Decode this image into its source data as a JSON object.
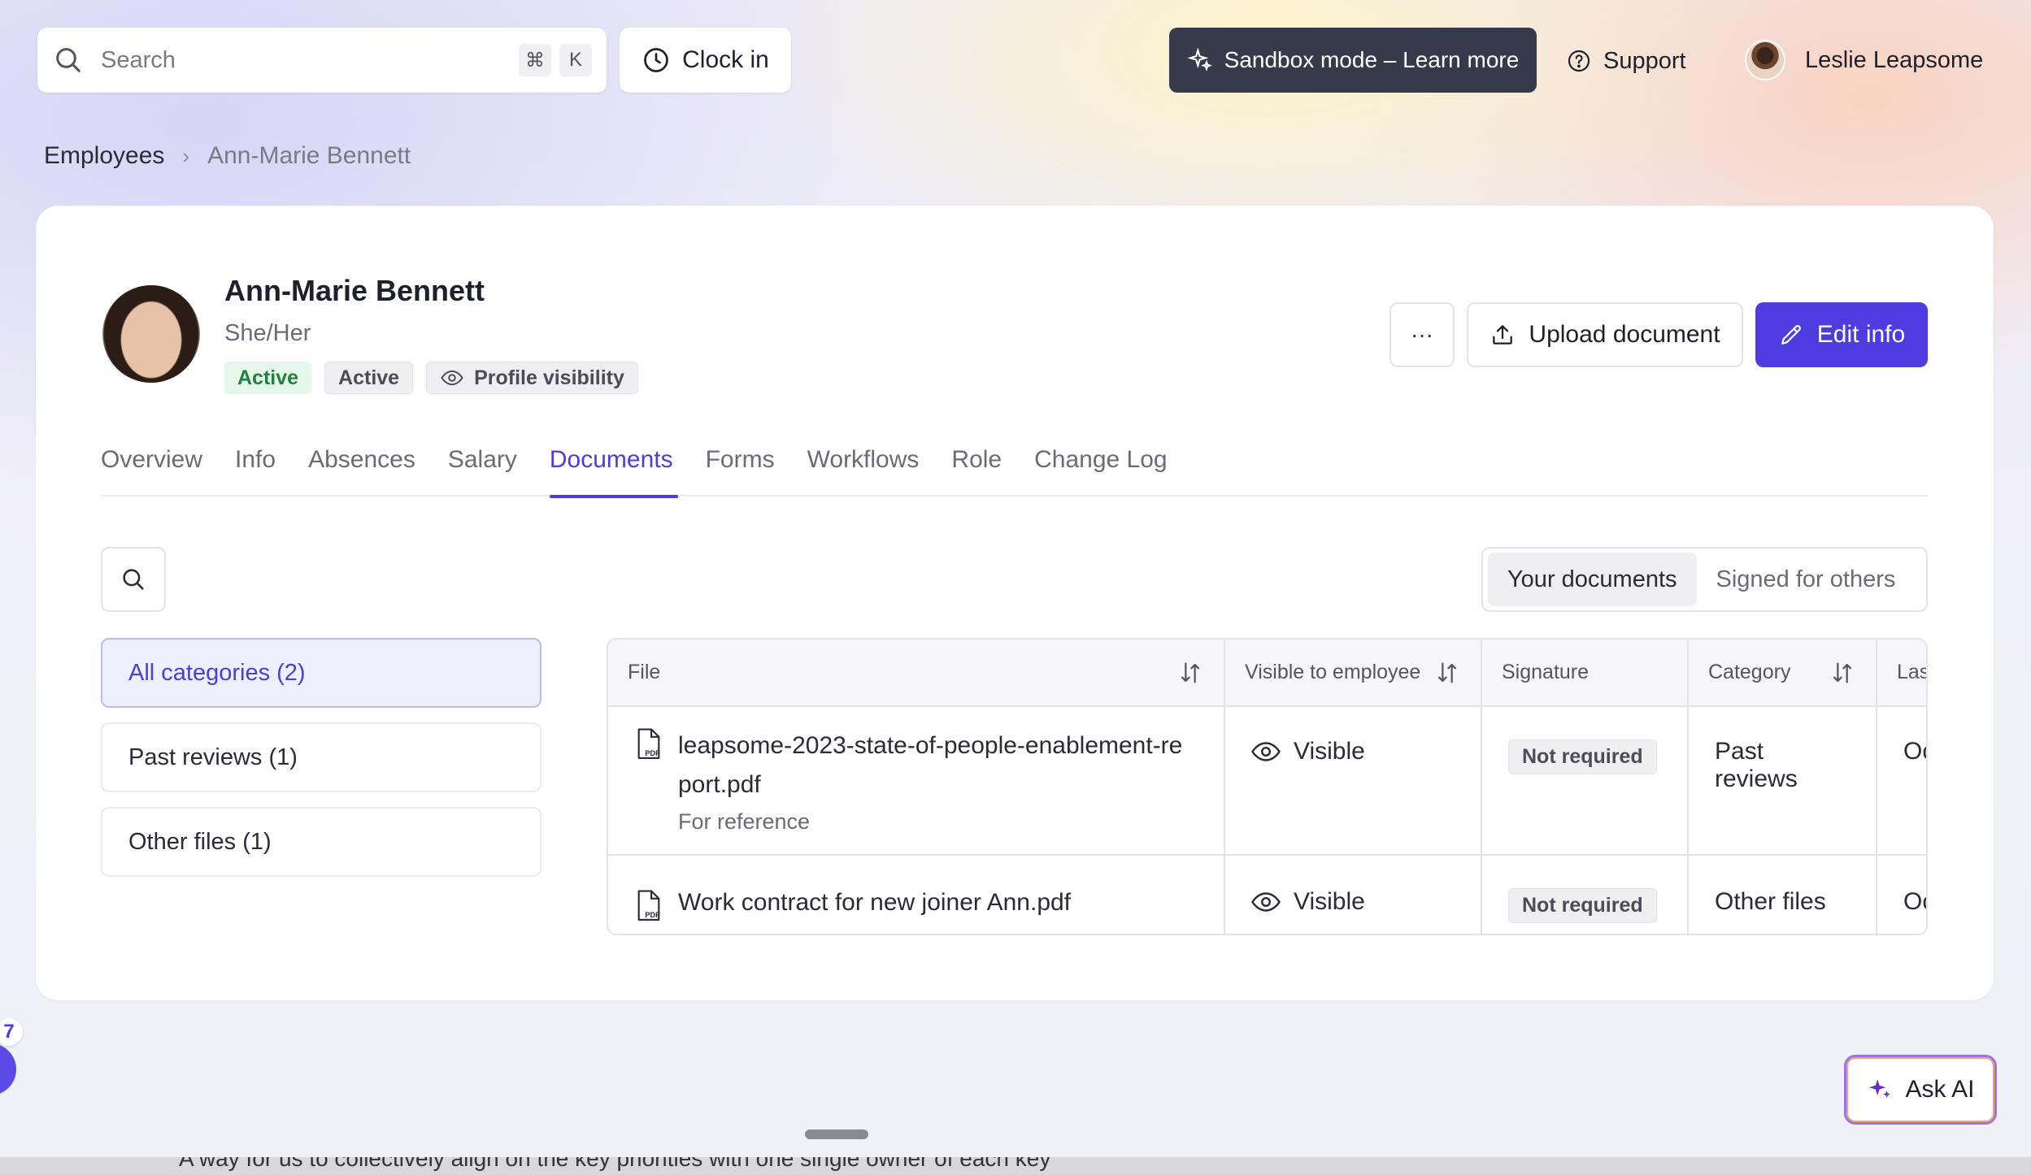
{
  "header": {
    "search_placeholder": "Search",
    "kbd_cmd": "⌘",
    "kbd_k": "K",
    "clock_in": "Clock in",
    "sandbox": "Sandbox mode – Learn more",
    "support": "Support",
    "user_name": "Leslie Leapsome"
  },
  "breadcrumb": {
    "parent": "Employees",
    "current": "Ann-Marie Bennett"
  },
  "profile": {
    "name": "Ann-Marie Bennett",
    "pronouns": "She/Her",
    "badge_status_green": "Active",
    "badge_status_gray": "Active",
    "badge_visibility": "Profile visibility",
    "more": "···",
    "upload": "Upload document",
    "edit": "Edit info"
  },
  "tabs": [
    {
      "label": "Overview"
    },
    {
      "label": "Info"
    },
    {
      "label": "Absences"
    },
    {
      "label": "Salary"
    },
    {
      "label": "Documents"
    },
    {
      "label": "Forms"
    },
    {
      "label": "Workflows"
    },
    {
      "label": "Role"
    },
    {
      "label": "Change Log"
    }
  ],
  "active_tab": "Documents",
  "toggle": {
    "yours": "Your documents",
    "others": "Signed for others"
  },
  "categories": [
    {
      "label": "All categories (2)"
    },
    {
      "label": "Past reviews (1)"
    },
    {
      "label": "Other files (1)"
    }
  ],
  "table": {
    "columns": [
      "File",
      "Visible to employee",
      "Signature",
      "Category",
      "Las"
    ],
    "rows": [
      {
        "file": "leapsome-2023-state-of-people-enablement-report.pdf",
        "file_line1": "leapsome-2023-state-of-people-enablement-re",
        "file_line2": "port.pdf",
        "note": "For reference",
        "visible": "Visible",
        "signature": "Not required",
        "category": "Past reviews",
        "last": "Oc"
      },
      {
        "file": "Work contract for new joiner Ann.pdf",
        "visible": "Visible",
        "signature": "Not required",
        "category": "Other files",
        "last": "Oc"
      }
    ]
  },
  "side_badge_count": "7",
  "ask_ai": "Ask AI",
  "bottom_text": "A way for us to collectively align on the key priorities with one single owner of each key",
  "colors": {
    "accent": "#4f3ce0",
    "sandbox_bg": "#363a4a",
    "active_badge_bg": "#e5f6ea",
    "active_badge_text": "#23803f"
  }
}
